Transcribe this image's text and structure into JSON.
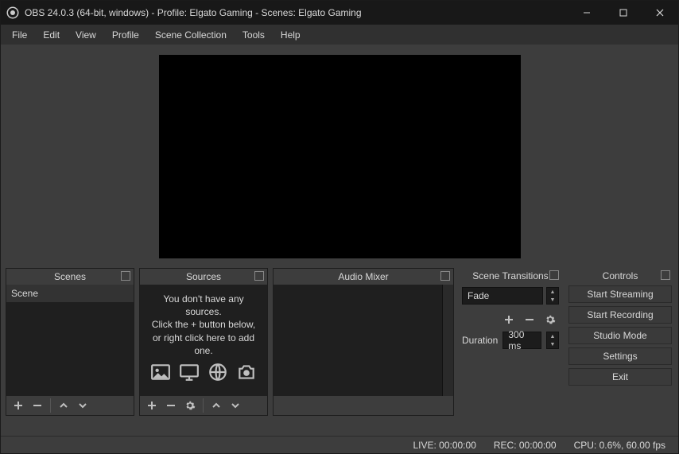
{
  "titlebar": {
    "title": "OBS 24.0.3 (64-bit, windows) - Profile: Elgato Gaming - Scenes: Elgato Gaming"
  },
  "menu": {
    "file": "File",
    "edit": "Edit",
    "view": "View",
    "profile": "Profile",
    "scene_collection": "Scene Collection",
    "tools": "Tools",
    "help": "Help"
  },
  "panels": {
    "scenes": {
      "title": "Scenes",
      "items": [
        "Scene"
      ]
    },
    "sources": {
      "title": "Sources",
      "empty_l1": "You don't have any sources.",
      "empty_l2": "Click the + button below,",
      "empty_l3": "or right click here to add one."
    },
    "mixer": {
      "title": "Audio Mixer"
    },
    "transitions": {
      "title": "Scene Transitions",
      "selected": "Fade",
      "duration_label": "Duration",
      "duration_value": "300 ms"
    },
    "controls": {
      "title": "Controls",
      "start_streaming": "Start Streaming",
      "start_recording": "Start Recording",
      "studio_mode": "Studio Mode",
      "settings": "Settings",
      "exit": "Exit"
    }
  },
  "status": {
    "live": "LIVE: 00:00:00",
    "rec": "REC: 00:00:00",
    "cpu": "CPU: 0.6%, 60.00 fps"
  }
}
